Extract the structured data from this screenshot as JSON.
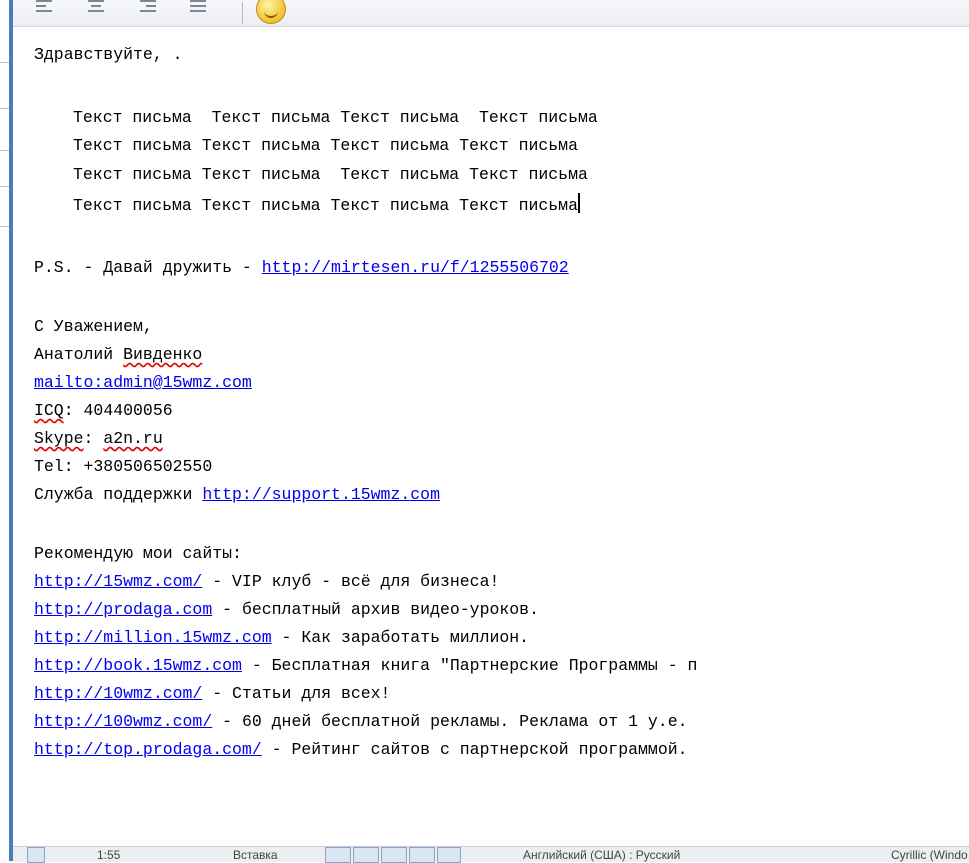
{
  "toolbar": {
    "icons": [
      "align-left-icon",
      "align-center-icon",
      "align-right-icon",
      "align-justify-icon",
      "smiley-icon"
    ]
  },
  "letter": {
    "greeting": "Здравствуйте, .",
    "body_lines": [
      "Текст письма  Текст письма Текст письма  Текст письма",
      "Текст письма Текст письма Текст письма Текст письма",
      "Текст письма Текст письма  Текст письма Текст письма",
      "Текст письма Текст письма Текст письма Текст письма"
    ],
    "ps_prefix": "P.S. - Давай дружить - ",
    "ps_link": "http://mirtesen.ru/f/1255506702",
    "regards": "С Уважением,",
    "name_first": "Анатолий ",
    "name_last": "Вивденко",
    "mailto": "mailto:admin@15wmz.com",
    "icq_label": "ICQ",
    "icq_value": ": 404400056",
    "skype_label": "Skype",
    "skype_sep": ": ",
    "skype_value": "a2n.ru",
    "tel": "Tel: +380506502550",
    "support_label": "Служба поддержки ",
    "support_link": "http://support.15wmz.com",
    "recommend": "Рекомендую мои сайты:",
    "sites": [
      {
        "url": "http://15wmz.com/",
        "text": " - VIP клуб - всё для бизнеса!"
      },
      {
        "url": "http://prodaga.com",
        "text": " - бесплатный архив видео-уроков."
      },
      {
        "url": "http://million.15wmz.com",
        "text": " - Как заработать миллион."
      },
      {
        "url": "http://book.15wmz.com",
        "text": " - Бесплатная книга \"Партнерские Программы - п"
      },
      {
        "url": "http://10wmz.com/",
        "text": " - Статьи для всех!"
      },
      {
        "url": "http://100wmz.com/",
        "text": " - 60 дней бесплатной рекламы. Реклама от 1 у.е."
      },
      {
        "url": "http://top.prodaga.com/",
        "text": " - Рейтинг сайтов с партнерской программой."
      }
    ]
  },
  "statusbar": {
    "zoom": "1:55",
    "mode": "Вставка",
    "language": "Английский (США) : Русский",
    "encoding": "Cyrillic (Windo"
  },
  "colors": {
    "link": "#0000ee",
    "spell_error": "#e00000",
    "edge_bar": "#4a7bbf"
  }
}
